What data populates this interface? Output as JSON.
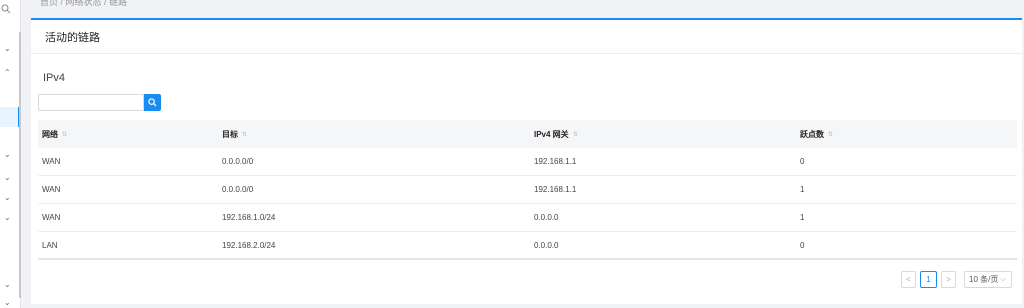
{
  "breadcrumb": "首页 / 网络状态 / 链路",
  "card": {
    "title": "活动的链路"
  },
  "section": {
    "title": "IPv4"
  },
  "search": {
    "value": "",
    "placeholder": ""
  },
  "table": {
    "headers": [
      "网络",
      "目标",
      "IPv4 网关",
      "跃点数"
    ],
    "rows": [
      [
        "WAN",
        "0.0.0.0/0",
        "192.168.1.1",
        "0"
      ],
      [
        "WAN",
        "0.0.0.0/0",
        "192.168.1.1",
        "1"
      ],
      [
        "WAN",
        "192.168.1.0/24",
        "0.0.0.0",
        "1"
      ],
      [
        "LAN",
        "192.168.2.0/24",
        "0.0.0.0",
        "0"
      ]
    ]
  },
  "pagination": {
    "prev": "<",
    "page": "1",
    "next": ">",
    "page_size": "10 条/页"
  },
  "colors": {
    "accent": "#1a8cf0",
    "header_bg": "#f5f6f8"
  },
  "icons": {
    "search": "search-icon",
    "sort": "sort-icon",
    "chevron": "chevron-down-icon"
  }
}
